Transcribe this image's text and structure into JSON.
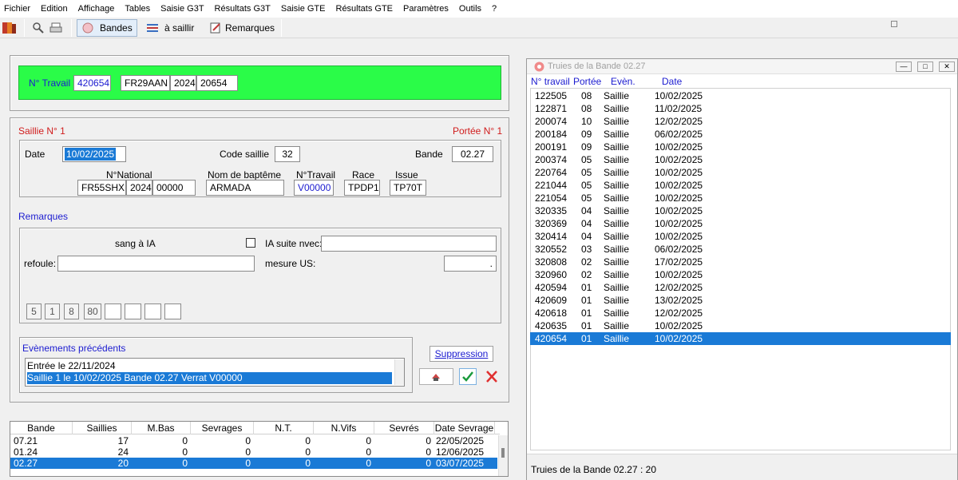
{
  "menu": [
    "Fichier",
    "Edition",
    "Affichage",
    "Tables",
    "Saisie G3T",
    "Résultats G3T",
    "Saisie GTE",
    "Résultats GTE",
    "Paramètres",
    "Outils",
    "?"
  ],
  "toolbar": {
    "bandes": "Bandes",
    "a_saillir": "à saillir",
    "remarques": "Remarques"
  },
  "travail": {
    "label": "N° Travail",
    "number": "420654",
    "code": "FR29AAN",
    "year": "2024",
    "id": "20654"
  },
  "saillie": {
    "title": "Saillie N° 1",
    "portee": "Portée N° 1",
    "date_label": "Date",
    "date": "10/02/2025",
    "code_label": "Code saillie",
    "code": "32",
    "bande_label": "Bande",
    "bande": "02.27",
    "national_label": "N°National",
    "national_code": "FR55SHX",
    "national_year": "2024",
    "national_num": "00000",
    "bapteme_label": "Nom de baptême",
    "bapteme": "ARMADA",
    "travail_label": "N°Travail",
    "travail": "V00000",
    "race_label": "Race",
    "race": "TPDP1",
    "issue_label": "Issue",
    "issue": "TP70T"
  },
  "remarques": {
    "title": "Remarques",
    "sang": "sang à IA",
    "ia_suite": "IA suite nvec:",
    "refoule": "refoule:",
    "mesure": "mesure US:",
    "mesure_value": ".",
    "scores": [
      "5",
      "1",
      "8",
      "80"
    ]
  },
  "evenements": {
    "title": "Evènements précédents",
    "items": [
      "Entrée le 22/11/2024",
      "Saillie 1 le 10/02/2025 Bande 02.27 Verrat V00000"
    ],
    "suppression": "Suppression"
  },
  "bandes_table": {
    "headers": [
      "Bande",
      "Saillies",
      "M.Bas",
      "Sevrages",
      "N.T.",
      "N.Vifs",
      "Sevrés",
      "Date Sevrage"
    ],
    "rows": [
      [
        "07.21",
        "17",
        "0",
        "0",
        "0",
        "0",
        "0",
        "22/05/2025"
      ],
      [
        "01.24",
        "24",
        "0",
        "0",
        "0",
        "0",
        "0",
        "12/06/2025"
      ],
      [
        "02.27",
        "20",
        "0",
        "0",
        "0",
        "0",
        "0",
        "03/07/2025"
      ]
    ]
  },
  "truies": {
    "title": "Truies de la Bande 02.27",
    "headers": [
      "N° travail",
      "Portée",
      "Evèn.",
      "Date"
    ],
    "rows": [
      [
        "122505",
        "08",
        "Saillie",
        "10/02/2025"
      ],
      [
        "122871",
        "08",
        "Saillie",
        "11/02/2025"
      ],
      [
        "200074",
        "10",
        "Saillie",
        "12/02/2025"
      ],
      [
        "200184",
        "09",
        "Saillie",
        "06/02/2025"
      ],
      [
        "200191",
        "09",
        "Saillie",
        "10/02/2025"
      ],
      [
        "200374",
        "05",
        "Saillie",
        "10/02/2025"
      ],
      [
        "220764",
        "05",
        "Saillie",
        "10/02/2025"
      ],
      [
        "221044",
        "05",
        "Saillie",
        "10/02/2025"
      ],
      [
        "221054",
        "05",
        "Saillie",
        "10/02/2025"
      ],
      [
        "320335",
        "04",
        "Saillie",
        "10/02/2025"
      ],
      [
        "320369",
        "04",
        "Saillie",
        "10/02/2025"
      ],
      [
        "320414",
        "04",
        "Saillie",
        "10/02/2025"
      ],
      [
        "320552",
        "03",
        "Saillie",
        "06/02/2025"
      ],
      [
        "320808",
        "02",
        "Saillie",
        "17/02/2025"
      ],
      [
        "320960",
        "02",
        "Saillie",
        "10/02/2025"
      ],
      [
        "420594",
        "01",
        "Saillie",
        "12/02/2025"
      ],
      [
        "420609",
        "01",
        "Saillie",
        "13/02/2025"
      ],
      [
        "420618",
        "01",
        "Saillie",
        "12/02/2025"
      ],
      [
        "420635",
        "01",
        "Saillie",
        "10/02/2025"
      ],
      [
        "420654",
        "01",
        "Saillie",
        "10/02/2025"
      ]
    ],
    "footer": "Truies de la Bande 02.27 : 20"
  },
  "colors": {
    "accent": "#1a7ad6",
    "green_panel": "#2afc48",
    "red_label": "#d01c1c",
    "blue_label": "#1c1cd0"
  }
}
